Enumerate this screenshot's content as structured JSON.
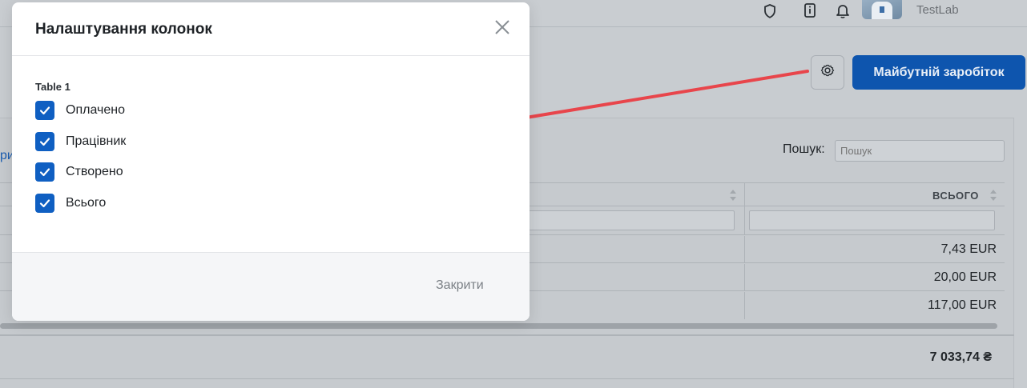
{
  "topbar": {
    "username": "TestLab"
  },
  "toolbar": {
    "primary_button": "Майбутній заробіток"
  },
  "table": {
    "left_link_fragment": "ри",
    "search_label": "Пошук:",
    "search_placeholder": "Пошук",
    "total_header": "ВСЬОГО",
    "rows": [
      {
        "total": "7,43 EUR"
      },
      {
        "total": "20,00 EUR"
      },
      {
        "total": "117,00 EUR"
      }
    ],
    "footer_total": "7 033,74 ₴"
  },
  "modal": {
    "title": "Налаштування колонок",
    "group_label": "Table 1",
    "options": [
      {
        "label": "Оплачено",
        "checked": true
      },
      {
        "label": "Працівник",
        "checked": true
      },
      {
        "label": "Створено",
        "checked": true
      },
      {
        "label": "Всього",
        "checked": true
      }
    ],
    "close_label": "Закрити"
  },
  "icons": {
    "topbar": [
      "shield-icon",
      "info-icon",
      "bell-icon"
    ],
    "settings": "gear-icon",
    "modal_close": "close-icon",
    "checkbox": "check-icon"
  },
  "colors": {
    "primary": "#0e55ae",
    "checkbox": "#0f5fc2",
    "arrow": "#e8454b"
  }
}
